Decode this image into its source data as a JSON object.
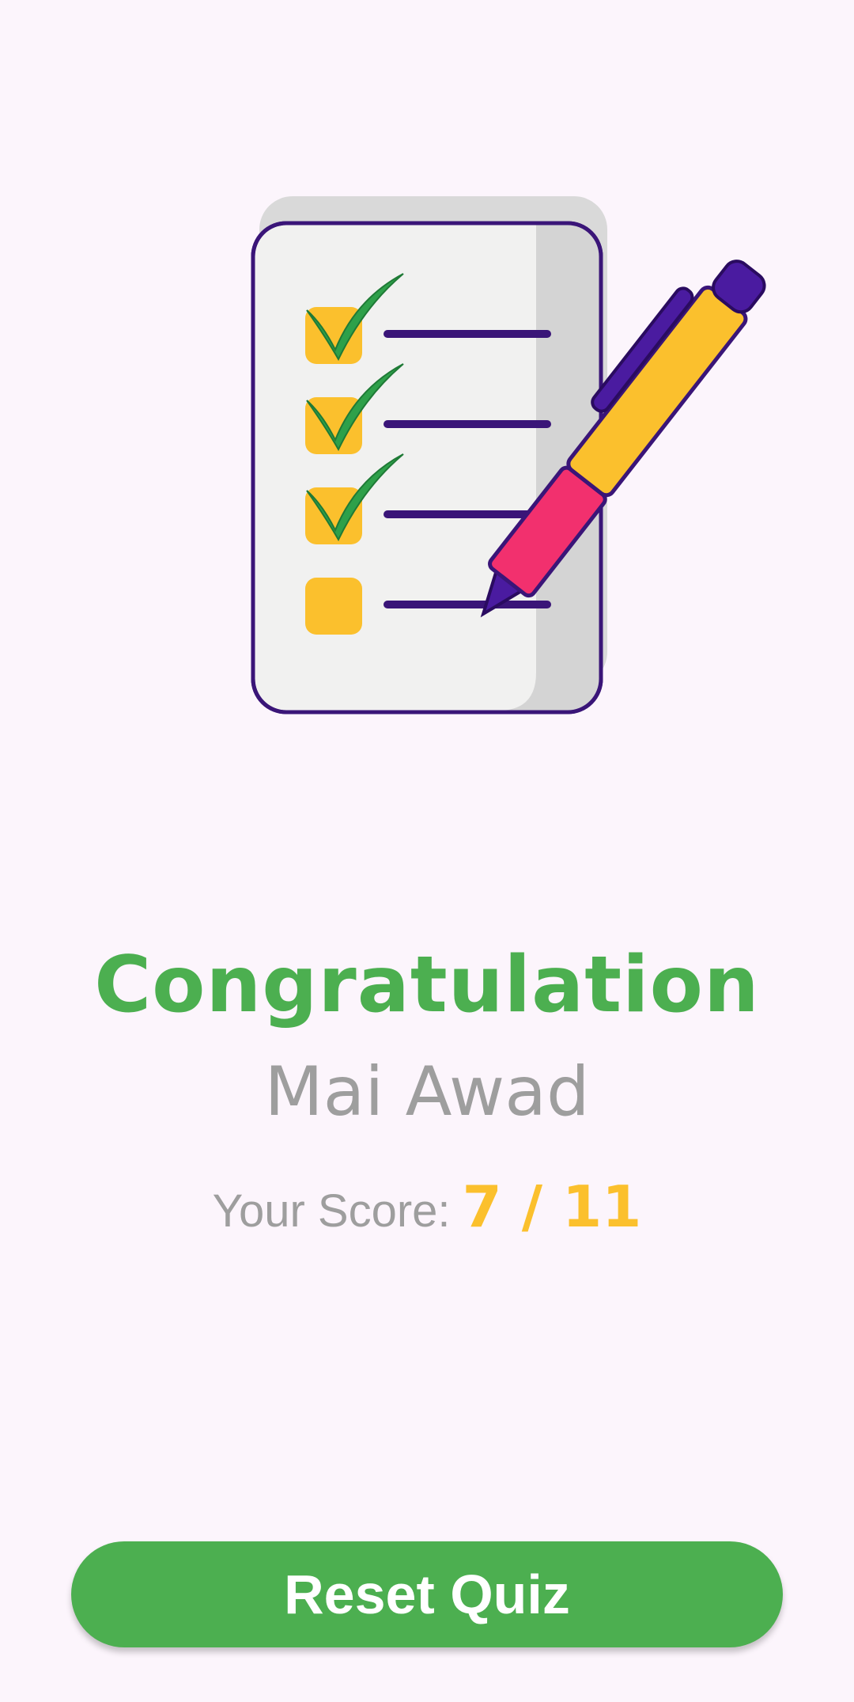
{
  "illustration": {
    "icon": "checklist-with-pen-icon",
    "checked_items": 3,
    "total_items": 4
  },
  "result": {
    "title": "Congratulation",
    "user_name": "Mai Awad",
    "score_label": "Your Score:",
    "score_value": "7 / 11"
  },
  "actions": {
    "reset_label": "Reset Quiz"
  },
  "colors": {
    "background": "#FCF5FC",
    "title": "#4CAF50",
    "secondary_text": "#9E9E9E",
    "score": "#FBC02D",
    "button": "#4CAF50",
    "button_text": "#FFFFFF"
  }
}
